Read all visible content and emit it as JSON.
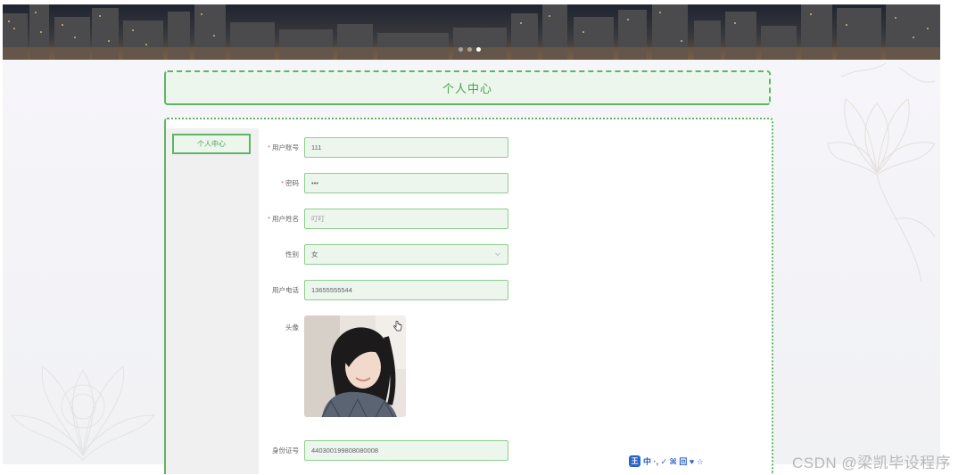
{
  "page": {
    "title": "个人中心"
  },
  "sidebar": {
    "items": [
      {
        "label": "个人中心"
      }
    ]
  },
  "banner": {
    "carousel_dots": 3,
    "active_dot": 3
  },
  "form": {
    "fields": [
      {
        "key": "account",
        "label": "用户账号",
        "required": true,
        "value": "111"
      },
      {
        "key": "password",
        "label": "密码",
        "required": true,
        "value": "•••"
      },
      {
        "key": "name",
        "label": "用户姓名",
        "required": true,
        "value": "叮叮"
      },
      {
        "key": "gender",
        "label": "性别",
        "required": false,
        "value": "女",
        "type": "select"
      },
      {
        "key": "phone",
        "label": "用户电话",
        "required": false,
        "value": "13655555544"
      },
      {
        "key": "avatar",
        "label": "头像",
        "required": false,
        "type": "image"
      },
      {
        "key": "idcard",
        "label": "身份证号",
        "required": false,
        "value": "440300199808080008"
      }
    ]
  },
  "floating_toolbar": {
    "badge": "王",
    "glyphs": "中 ·, ✓ ⌘ 回 ♥ ☆"
  },
  "watermark": "CSDN @梁凯毕设程序",
  "colors": {
    "accent": "#5eb564",
    "accent_bg": "#ecf6ec",
    "required": "#e05a5a"
  }
}
